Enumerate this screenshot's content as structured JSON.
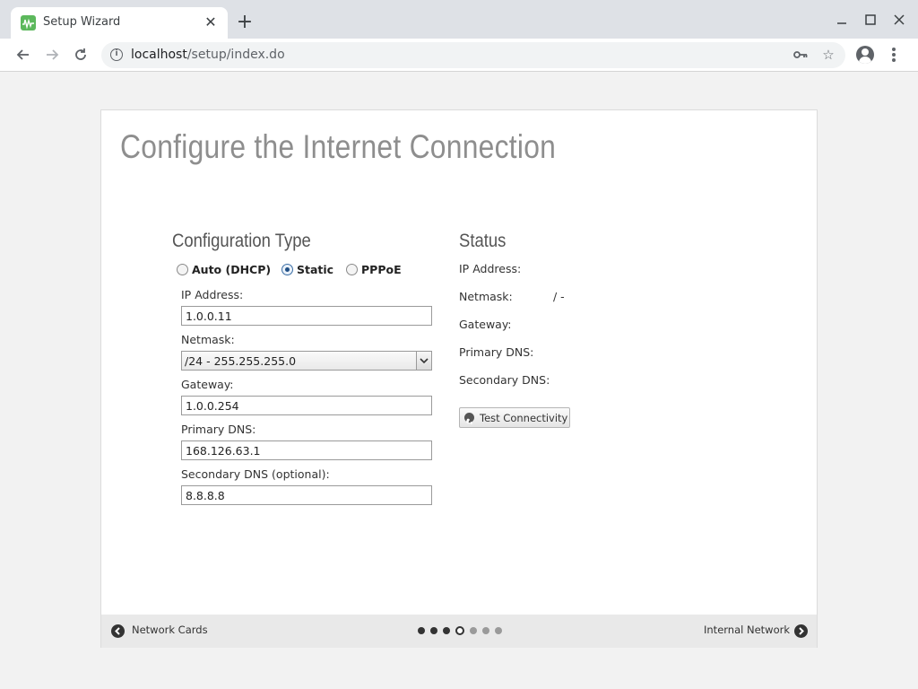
{
  "browser": {
    "tab_title": "Setup Wizard",
    "url_host": "localhost",
    "url_path": "/setup/index.do"
  },
  "page": {
    "title": "Configure the Internet Connection"
  },
  "config": {
    "heading": "Configuration Type",
    "options": [
      {
        "label": "Auto (DHCP)",
        "checked": false
      },
      {
        "label": "Static",
        "checked": true
      },
      {
        "label": "PPPoE",
        "checked": false
      }
    ],
    "fields": {
      "ip_label": "IP Address:",
      "ip_value": "1.0.0.11",
      "netmask_label": "Netmask:",
      "netmask_value": "/24 - 255.255.255.0",
      "gateway_label": "Gateway:",
      "gateway_value": "1.0.0.254",
      "dns1_label": "Primary DNS:",
      "dns1_value": "168.126.63.1",
      "dns2_label": "Secondary DNS (optional):",
      "dns2_value": "8.8.8.8"
    }
  },
  "status": {
    "heading": "Status",
    "ip_label": "IP Address:",
    "netmask_label": "Netmask:",
    "netmask_value": "/ -",
    "gateway_label": "Gateway:",
    "dns1_label": "Primary DNS:",
    "dns2_label": "Secondary DNS:",
    "test_button": "Test Connectivity"
  },
  "footer": {
    "prev_label": "Network Cards",
    "next_label": "Internal Network",
    "steps_total": 7,
    "current_step": 4
  },
  "icons": {
    "favicon": "waveform-icon",
    "globe": "globe-icon"
  },
  "colors": {
    "favicon_bg": "#5cb85c",
    "title": "#8e8e8e",
    "radio_checked": "#1f4f85"
  }
}
